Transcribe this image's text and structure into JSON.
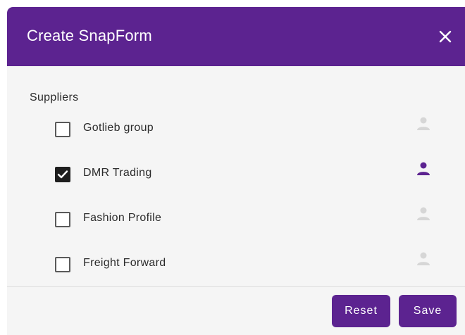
{
  "dialog": {
    "title": "Create SnapForm",
    "close_icon": "close-icon"
  },
  "suppliers": {
    "label": "Suppliers",
    "items": [
      {
        "label": "Gotlieb group",
        "checked": false,
        "assigned": false
      },
      {
        "label": "DMR Trading",
        "checked": true,
        "assigned": true
      },
      {
        "label": "Fashion Profile",
        "checked": false,
        "assigned": false
      },
      {
        "label": "Freight Forward",
        "checked": false,
        "assigned": false
      }
    ]
  },
  "footer": {
    "reset_label": "Reset",
    "save_label": "Save"
  },
  "colors": {
    "brand": "#5c2390",
    "user_active": "#5c2390",
    "user_inactive": "#d6d6d6"
  }
}
